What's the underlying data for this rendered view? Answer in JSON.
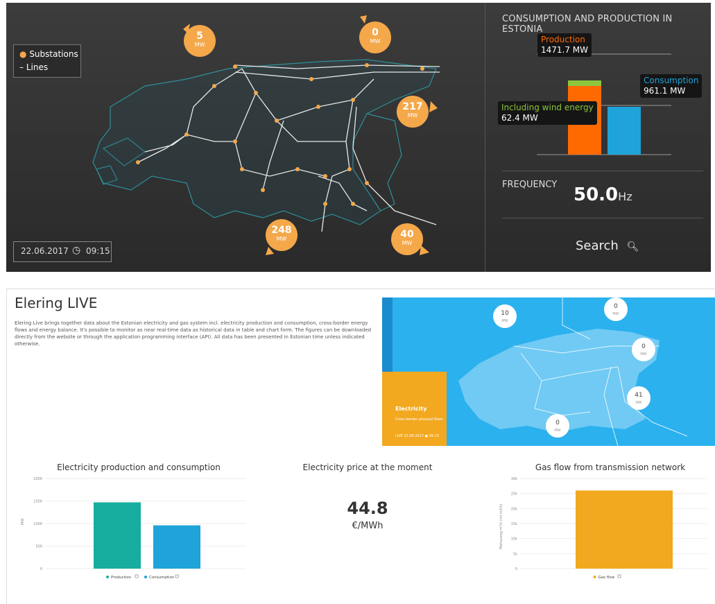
{
  "top": {
    "legend": {
      "substations": "Substations",
      "lines": "Lines"
    },
    "date": "22.06.2017",
    "time": "09:15",
    "flows": [
      {
        "value": "5",
        "unit": "MW"
      },
      {
        "value": "0",
        "unit": "MW"
      },
      {
        "value": "217",
        "unit": "MW"
      },
      {
        "value": "248",
        "unit": "MW"
      },
      {
        "value": "40",
        "unit": "MW"
      }
    ],
    "side": {
      "title": "CONSUMPTION AND PRODUCTION IN ESTONIA",
      "production_label": "Production",
      "production_value": "1471.7 MW",
      "consumption_label": "Consumption",
      "consumption_value": "961.1 MW",
      "wind_label": "Including wind energy",
      "wind_value": "62.4 MW",
      "frequency_label": "FREQUENCY",
      "frequency_value": "50.0",
      "frequency_unit": "Hz",
      "search_label": "Search"
    },
    "colors": {
      "production": "#ff6a00",
      "consumption": "#1fa3d8",
      "wind": "#8cc63f",
      "flow": "#f4a84a"
    }
  },
  "bottom": {
    "title": "Elering LIVE",
    "description": "Elering Live brings together data about the Estonian electricity and gas system incl. electricity production and consumption, cross-border energy flows and energy balance. It's possible to monitor as near real-time data as historical data in table and chart form. The figures can be downloaded directly from the website or through the application programming interface (API). All data has been presented in Estonian time unless indicated otherwise.",
    "mini_map": {
      "panel_title": "Electricity",
      "panel_sub": "Cross-border physical flows",
      "panel_date": "LIVE 22.06.2017",
      "panel_time": "09:15",
      "bubbles": [
        {
          "value": "10",
          "unit": "MW"
        },
        {
          "value": "0",
          "unit": "MW"
        },
        {
          "value": "0",
          "unit": "MW"
        },
        {
          "value": "41",
          "unit": "MW"
        },
        {
          "value": "0",
          "unit": "MW"
        }
      ]
    },
    "price": {
      "title": "Electricity price at the moment",
      "value": "44.8",
      "unit": "€/MWh"
    }
  },
  "chart_data": [
    {
      "type": "bar",
      "title": "CONSUMPTION AND PRODUCTION IN ESTONIA",
      "categories": [
        "Production",
        "Consumption"
      ],
      "values": [
        1471.7,
        961.1
      ],
      "stacked_component": {
        "name": "Including wind energy",
        "value": 62.4,
        "on": "Production"
      },
      "colors": [
        "#ff6a00",
        "#1fa3d8"
      ]
    },
    {
      "type": "bar",
      "title": "Electricity production and consumption",
      "ylabel": "MW",
      "yticks": [
        "0",
        "500",
        "1000",
        "1500",
        "2000"
      ],
      "ylim": [
        0,
        2000
      ],
      "series": [
        {
          "name": "Production",
          "value": 1470,
          "color": "#17ad9f"
        },
        {
          "name": "Consumption",
          "value": 960,
          "color": "#1fa3d8"
        }
      ],
      "legend": "bottom"
    },
    {
      "type": "bar",
      "title": "Gas flow from transmission network",
      "ylabel": "Mahuvoog m³/h (ml m3/h)",
      "yticks": [
        "0",
        "5k",
        "10k",
        "15k",
        "20k",
        "25k",
        "30k"
      ],
      "ylim": [
        0,
        30000
      ],
      "series": [
        {
          "name": "Gas flow",
          "value": 26000,
          "color": "#f2a81f"
        }
      ],
      "legend": "bottom"
    }
  ]
}
